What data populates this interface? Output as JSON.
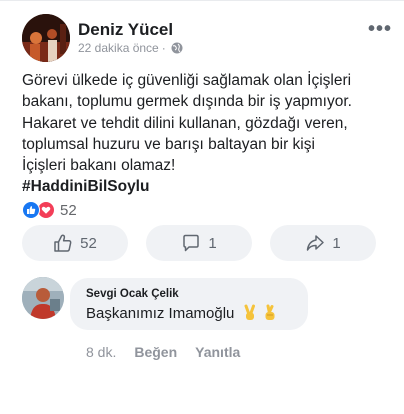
{
  "post": {
    "author": "Deniz Yücel",
    "time": "22 dakika önce",
    "separator": "·",
    "more": "•••",
    "text_lines": [
      "Görevi ülkede iç güvenliği sağlamak olan İçişleri",
      "bakanı, toplumu germek dışında bir iş yapmıyor.",
      "Hakaret ve tehdit dilini kullanan, gözdağı veren,",
      "toplumsal huzuru ve barışı baltayan bir kişi",
      "İçişleri bakanı olamaz!"
    ],
    "hashtag": "#HaddiniBilSoylu",
    "reactions_count": "52",
    "actions": {
      "like_count": "52",
      "comment_count": "1",
      "share_count": "1"
    }
  },
  "comment": {
    "author": "Sevgi Ocak Çelik",
    "text": "Başkanımız Imamoğlu",
    "emojis": [
      "victory-hand",
      "crossed-fingers"
    ],
    "time": "8 dk.",
    "like_label": "Beğen",
    "reply_label": "Yanıtla"
  },
  "colors": {
    "like_blue": "#1877f2",
    "love_red": "#f33e58",
    "button_bg": "#f0f2f5",
    "muted_text": "#90949c"
  }
}
